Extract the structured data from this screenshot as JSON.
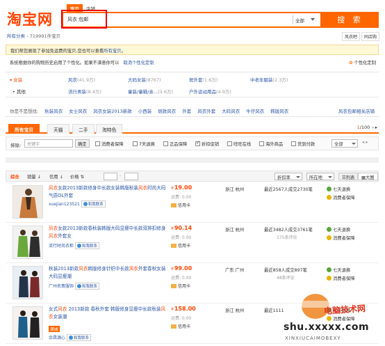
{
  "header": {
    "logo": "淘宝网",
    "tabs": [
      "宝贝",
      "店铺"
    ],
    "search_value": "风衣 包邮",
    "scope": "全部",
    "search_button": "搜 索"
  },
  "breadcrumb": {
    "root": "所有分类",
    "count": "719991件宝贝"
  },
  "view_tabs": [
    "风衣吧",
    "同店购"
  ],
  "notice": {
    "text": "我们帮您展现了参加免运费的宝贝,您也可以查看",
    "link": "所有宝贝",
    "end": "。"
  },
  "personal": {
    "text": "系统根据你的购物历史启用了个性化。如果不满意你可以",
    "link": "取消个性化定制",
    "button": "个性化定制"
  },
  "categories": {
    "group1": "女装",
    "group2": "其他",
    "row1": [
      {
        "name": "风衣",
        "count": "(41.9万)"
      },
      {
        "name": "大码女装",
        "count": "(8767)"
      },
      {
        "name": "斑外套",
        "count": "(1.6万)"
      },
      {
        "name": "中老年服装",
        "count": "(2.3万)"
      }
    ],
    "row2": [
      {
        "name": "流行男装",
        "count": "(8.4万)"
      },
      {
        "name": "童装/童鞋/亲...",
        "count": "(3.6万)"
      },
      {
        "name": "户外运动用品",
        "count": "(4.9万)"
      }
    ]
  },
  "maybe": {
    "lead": "你是不是想找:",
    "items": [
      "秋装风衣",
      "女士风衣",
      "风衣女装2013新款",
      "小西装",
      "斑款风衣",
      "外套",
      "风衣外套",
      "大码风衣",
      "牛仔风衣",
      "韩版风衣"
    ],
    "last": "风衣包邮相关店铺"
  },
  "search_tabs": [
    "所有宝贝",
    "天猫",
    "二手",
    "淘特色"
  ],
  "pager": {
    "current": "1",
    "total": "/100"
  },
  "filter": {
    "label": "排除:",
    "placeholder": "关键字",
    "confirm": "确定",
    "checks": [
      "消费者保障",
      "7天退换",
      "正品保障",
      "折扣促销",
      "旺旺在线",
      "海外商品",
      "货到付款"
    ],
    "region": "全部"
  },
  "sort": {
    "items": [
      "综合",
      "销量",
      "信用",
      "价格"
    ],
    "order": "折扣率",
    "location": "所在地",
    "views": [
      "列表",
      "大图"
    ]
  },
  "products": [
    {
      "title_parts": [
        "风衣",
        "女款2013新款修身中长款女装韩版秋装",
        "风衣",
        "时尚大码气质OL外套"
      ],
      "shop": "xuejian123521",
      "shop_badge": "和我联系",
      "price": "19.00",
      "ship": "运费: 0.00",
      "credit": "信用卡",
      "location": "浙江 杭州",
      "sales": "最近2567人成交2730笔",
      "reviews": "",
      "services": [
        "七天退换",
        "消费者保障"
      ]
    },
    {
      "title_parts": [
        "风衣",
        "女款2013新款春秋装韩版大码显瘦中长款双排扣修身",
        "风衣",
        "外套女"
      ],
      "shop": "流行时尚衣柜",
      "shop_badge": "和我联系",
      "price": "90.14",
      "ship": "运费: 0.00",
      "credit": "信用卡",
      "location": "浙江 杭州",
      "sales": "最近3482人成交3761笔",
      "reviews": "175条评论",
      "services": [
        "七天退换",
        "消费者保障"
      ]
    },
    {
      "title_parts": [
        "秋装2013新款",
        "风衣",
        "韩版修身针织中长款",
        "风衣",
        "外套春秋女装大码显瘦潮"
      ],
      "shop": "广州名賓服饰",
      "shop_badge": "和我联系",
      "price": "99.00",
      "ship": "运费: 0.00",
      "credit": "信用卡",
      "location": "广东 广州",
      "sales": "最近858人成交897笔",
      "reviews": "48条评论",
      "services": [
        "七天退换",
        "消费者保障"
      ]
    },
    {
      "title_parts": [
        "女式",
        "风衣",
        " 2013新款 春秋外套 韩版修身显瘦中长款秋装",
        "风衣",
        "女装潮"
      ],
      "tag": "满减",
      "shop": "余昌源心",
      "shop_badge": "和我联系",
      "price": "158.00",
      "ship": "运费: 0.00",
      "credit": "信用卡",
      "location": "浙江 杭州",
      "sales": "最近1111",
      "reviews": "",
      "services": [
        "七天退换",
        "消费者保障"
      ]
    }
  ],
  "watermark": {
    "cn": "电脑技术网",
    "url": "shu.xxxxx.com",
    "sub": "XINXIUCAIMOBEXY"
  },
  "colors": {
    "accent": "#ff6600",
    "link": "#2953a6",
    "price": "#ff4400"
  }
}
